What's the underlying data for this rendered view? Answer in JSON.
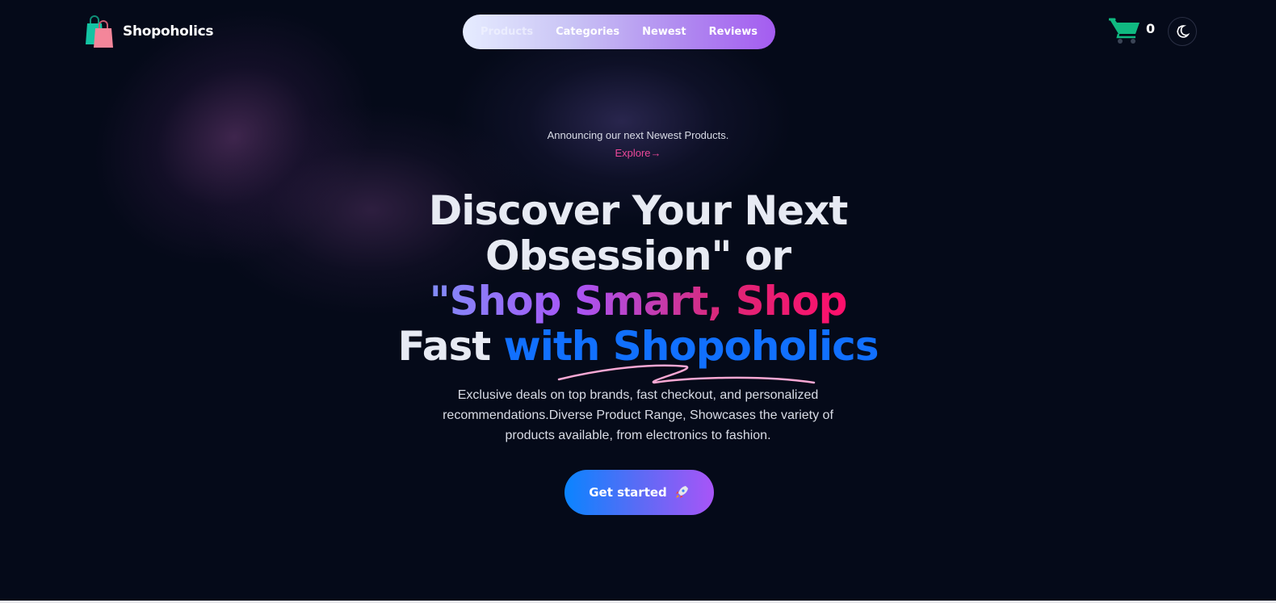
{
  "brand": {
    "name": "Shopoholics",
    "logo_icon": "shopping-bags-icon"
  },
  "nav": {
    "items": [
      {
        "label": "Products"
      },
      {
        "label": "Categories"
      },
      {
        "label": "Newest"
      },
      {
        "label": "Reviews"
      }
    ]
  },
  "cart": {
    "icon": "cart-icon",
    "count": "0",
    "color": "#10b981"
  },
  "theme_toggle": {
    "icon": "moon-stars-icon"
  },
  "hero": {
    "announce": "Announcing our next Newest Products.",
    "explore": "Explore→",
    "headline": {
      "line1": "Discover Your Next",
      "line2": "Obsession\" or",
      "line3": "\"Shop Smart, Shop",
      "line4a": "Fast",
      "line4b": "with Shopoholics"
    },
    "subtitle": "Exclusive deals on top brands, fast checkout, and personalized recommendations.Diverse Product Range, Showcases the variety of products available, from electronics to fashion.",
    "cta": {
      "label": "Get started",
      "icon": "rocket-icon"
    }
  },
  "colors": {
    "background": "#050a19",
    "accent_pink": "#ec4899",
    "accent_blue": "#1170ff",
    "accent_purple": "#a855f7"
  }
}
